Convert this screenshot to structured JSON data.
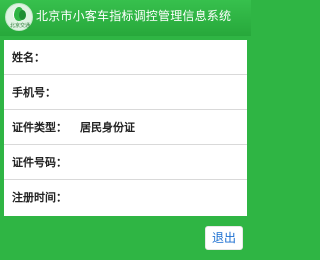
{
  "header": {
    "logo_text": "北京交通",
    "title": "北京市小客车指标调控管理信息系统"
  },
  "form": {
    "name_label": "姓名：",
    "name_value": "",
    "phone_label": "手机号：",
    "phone_value": "",
    "id_type_label": "证件类型：",
    "id_type_value": "居民身份证",
    "id_number_label": "证件号码：",
    "id_number_value": "",
    "reg_time_label": "注册时间：",
    "reg_time_value": ""
  },
  "actions": {
    "exit_label": "退出"
  },
  "colors": {
    "background": "#2fb544",
    "card": "#ffffff",
    "exit_text": "#1b6fd1"
  }
}
